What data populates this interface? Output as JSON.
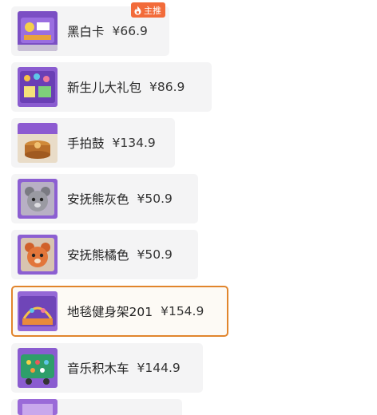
{
  "badge": {
    "label": "主推",
    "icon": "flame-icon",
    "color": "#f26b3a"
  },
  "accent_color": "#e1852c",
  "products": [
    {
      "name": "黑白卡",
      "price": "¥66.9",
      "selected": false
    },
    {
      "name": "新生儿大礼包",
      "price": "¥86.9",
      "selected": false
    },
    {
      "name": "手拍鼓",
      "price": "¥134.9",
      "selected": false
    },
    {
      "name": "安抚熊灰色",
      "price": "¥50.9",
      "selected": false
    },
    {
      "name": "安抚熊橘色",
      "price": "¥50.9",
      "selected": false
    },
    {
      "name": "地毯健身架201",
      "price": "¥154.9",
      "selected": true
    },
    {
      "name": "音乐积木车",
      "price": "¥144.9",
      "selected": false
    }
  ]
}
